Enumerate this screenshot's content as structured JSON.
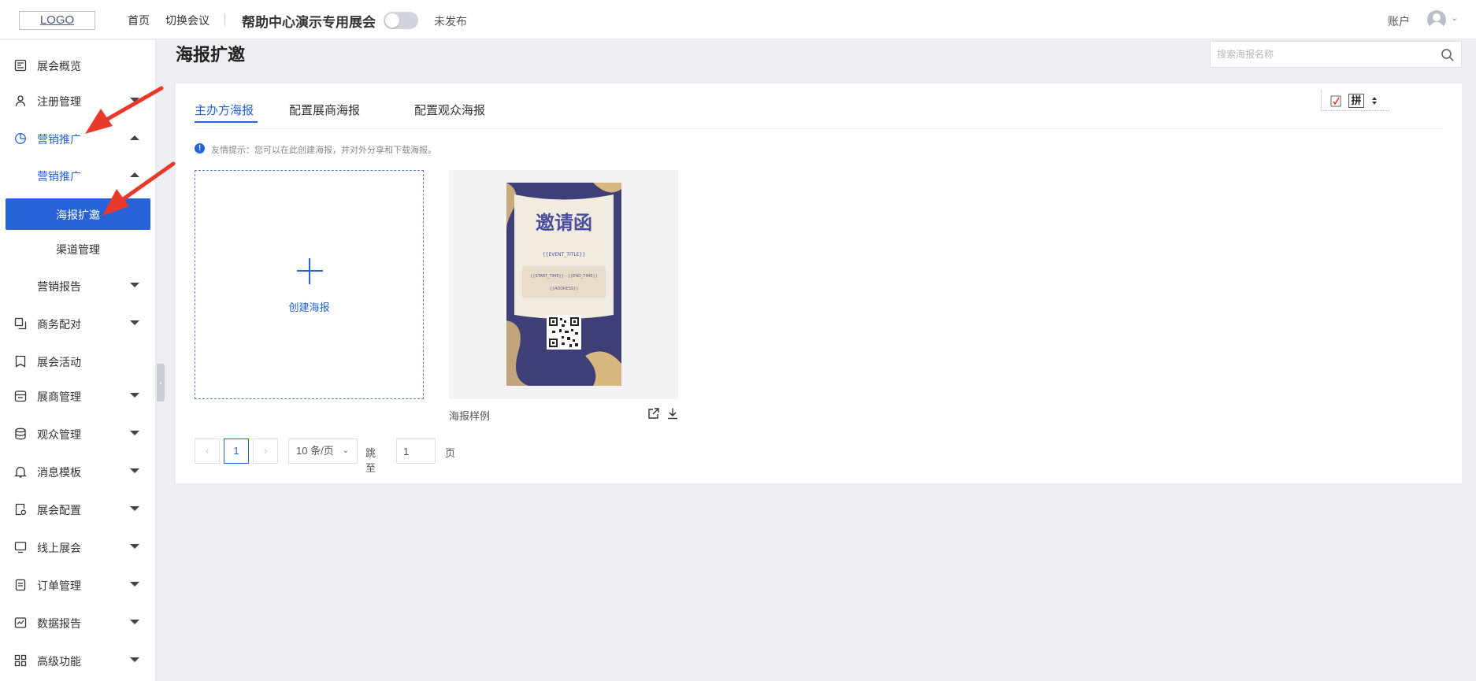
{
  "topbar": {
    "logo": "LOGO",
    "nav": [
      "首页",
      "切换会议"
    ],
    "expo_title": "帮助中心演示专用展会",
    "publish_status": "未发布",
    "account_label": "账户"
  },
  "sidebar": {
    "items": [
      {
        "label": "展会概览",
        "icon": "overview-icon"
      },
      {
        "label": "注册管理",
        "icon": "user-icon"
      },
      {
        "label": "营销推广",
        "icon": "pie-chart-icon",
        "expanded": true
      },
      {
        "label": "营销推广",
        "level": 2,
        "expanded": true
      },
      {
        "label": "海报扩邀",
        "level": 3,
        "selected": true
      },
      {
        "label": "渠道管理",
        "level": 3
      },
      {
        "label": "营销报告",
        "level": 2
      },
      {
        "label": "商务配对",
        "icon": "copy-icon"
      },
      {
        "label": "展会活动",
        "icon": "bookmark-icon"
      },
      {
        "label": "展商管理",
        "icon": "store-icon"
      },
      {
        "label": "观众管理",
        "icon": "database-icon"
      },
      {
        "label": "消息模板",
        "icon": "bell-icon"
      },
      {
        "label": "展会配置",
        "icon": "settings-doc-icon"
      },
      {
        "label": "线上展会",
        "icon": "monitor-icon"
      },
      {
        "label": "订单管理",
        "icon": "order-icon"
      },
      {
        "label": "数据报告",
        "icon": "chart-icon"
      },
      {
        "label": "高级功能",
        "icon": "grid-icon"
      }
    ]
  },
  "main": {
    "page_title": "海报扩邀",
    "search_placeholder": "搜索海报名称",
    "tabs": [
      {
        "label": "主办方海报",
        "active": true
      },
      {
        "label": "配置展商海报"
      },
      {
        "label": "配置观众海报"
      }
    ],
    "toolbar_char": "拼",
    "hint_icon": "!",
    "hint": "友情提示：您可以在此创建海报，并对外分享和下载海报。",
    "create_label": "创建海报",
    "poster": {
      "name": "海报样例",
      "headline": "邀请函",
      "event_title": "{{EVENT_TITLE}}",
      "time_range": "{{START_TIME}} - {{END_TIME}}",
      "address": "{{ADDRESS}}"
    },
    "pagination": {
      "prev": "‹",
      "next": "›",
      "current_page": "1",
      "page_size": "10 条/页",
      "jump_label": "跳至",
      "jump_value": "1",
      "page_label": "页"
    }
  },
  "colors": {
    "accent": "#2663d6",
    "annotation": "#e8392b",
    "poster_bg": "#3f3f78",
    "ribbon": "#d8b67d"
  }
}
